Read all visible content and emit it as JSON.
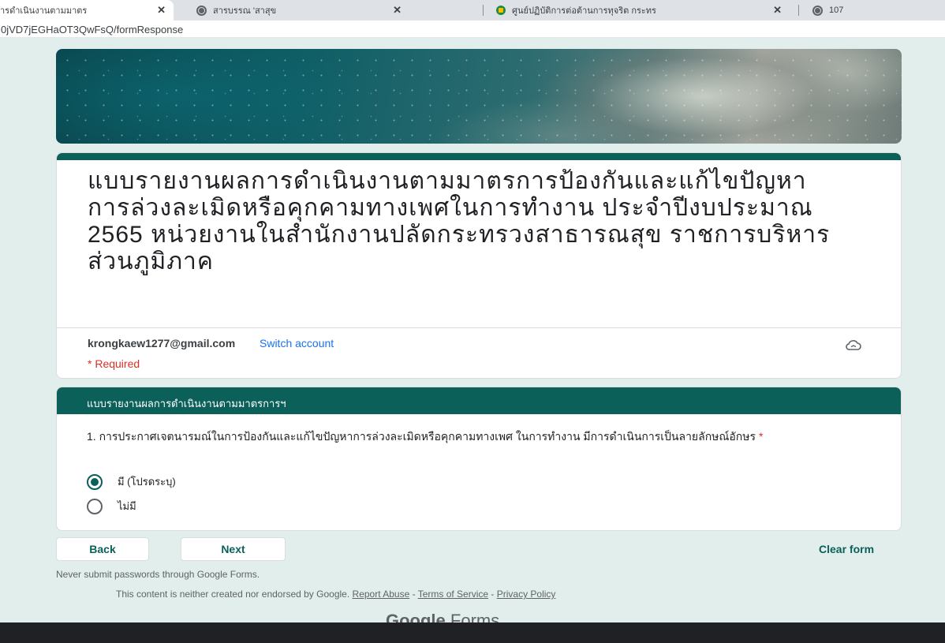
{
  "browser": {
    "tabs": [
      {
        "label": "ารดำเนินงานตามมาตร",
        "close": "✕"
      },
      {
        "label": "สารบรรณ 'สาสุข",
        "close": "✕"
      },
      {
        "label": "ศูนย์ปฏิบัติการต่อต้านการทุจริต กระทร",
        "close": "✕"
      },
      {
        "label": "107"
      }
    ],
    "address": "0jVD7jEGHaOT3QwFsQ/formResponse"
  },
  "form": {
    "title": "แบบรายงานผลการดำเนินงานตามมาตรการป้องกันและแก้ไขปัญหาการล่วงละเมิดหรือคุกคามทางเพศในการทำงาน ประจำปีงบประมาณ 2565 หน่วยงานในสำนักงานปลัดกระทรวงสาธารณสุข  ราชการบริหารส่วนภูมิภาค",
    "account_email": "krongkaew1277@gmail.com",
    "switch_account": "Switch account",
    "required_note": "* Required",
    "section_title": "แบบรายงานผลการดำเนินงานตามมาตรการฯ",
    "question": {
      "text": "1. การประกาศเจตนารมณ์ในการป้องกันและแก้ไขปัญหาการล่วงละเมิดหรือคุกคามทางเพศ ในการทำงาน มีการดำเนินการเป็นลายลักษณ์อักษร",
      "required_mark": "*",
      "options": [
        {
          "label": "มี (โปรดระบุ)",
          "selected": true
        },
        {
          "label": "ไม่มี",
          "selected": false
        }
      ]
    },
    "buttons": {
      "back": "Back",
      "next": "Next",
      "clear": "Clear form"
    }
  },
  "footer": {
    "password_warning": "Never submit passwords through Google Forms.",
    "disclaimer": "This content is neither created nor endorsed by Google.",
    "report_abuse": "Report Abuse",
    "terms": "Terms of Service",
    "privacy": "Privacy Policy",
    "separator": " - ",
    "brand_google": "Google",
    "brand_forms": "Forms"
  },
  "colors": {
    "theme": "#0c605a",
    "page_bg": "#e1eeec",
    "required": "#d93025",
    "link": "#1a73e8"
  }
}
